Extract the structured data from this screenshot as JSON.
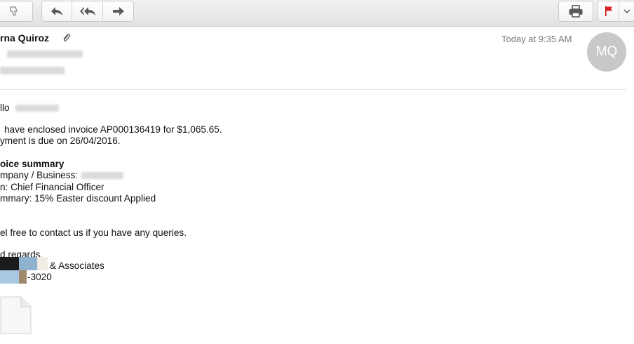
{
  "toolbar": {
    "buttons": [
      "thumbs-down-icon",
      "reply-icon",
      "reply-all-icon",
      "forward-icon",
      "print-icon",
      "flag-icon",
      "chevron-down-icon"
    ],
    "flag_color": "#e02020"
  },
  "header": {
    "sender": "rna Quiroz",
    "time": "Today at 9:35 AM",
    "avatar_initials": "MQ"
  },
  "message": {
    "greeting": "llo",
    "line1": "have enclosed invoice AP000136419 for $1,065.65.",
    "line2": "yment is due on 26/04/2016.",
    "summary_title": "oice summary",
    "company_label": "mpany / Business:",
    "attn": "n: Chief Financial Officer",
    "summary": "mmary: 15% Easter discount Applied",
    "contact": "el free to contact us if you have any queries.",
    "regards": "d regards,",
    "associates": "& Associates",
    "phone_suffix": "-3020"
  }
}
